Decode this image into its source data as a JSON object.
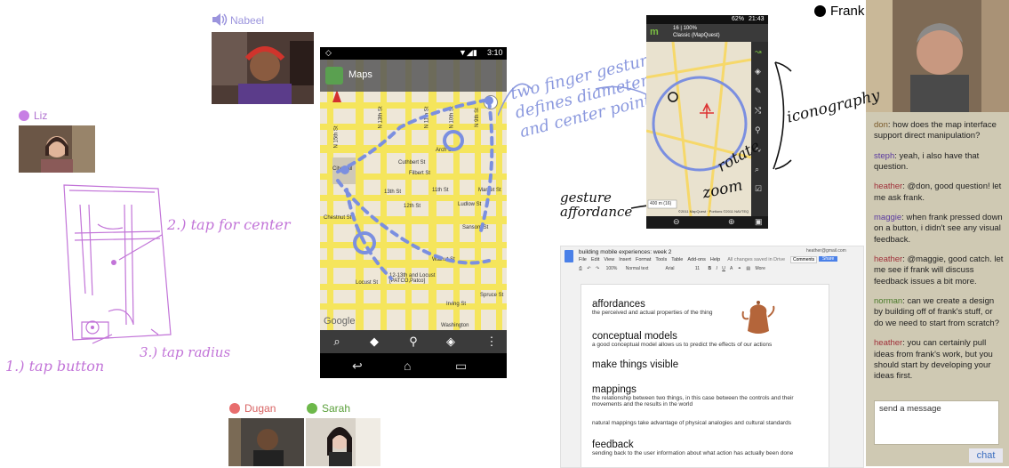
{
  "participants": {
    "nabeel": {
      "name": "Nabeel",
      "color": "#b0a8e6"
    },
    "liz": {
      "name": "Liz",
      "color": "#c77ee4"
    },
    "dugan": {
      "name": "Dugan",
      "color": "#e86d6d"
    },
    "sarah": {
      "name": "Sarah",
      "color": "#6db84a"
    },
    "frank": {
      "name": "Frank",
      "color": "#000000"
    }
  },
  "sketch": {
    "tap_center": "2.) tap for center",
    "tap_radius": "3.) tap radius",
    "tap_button": "1.) tap button"
  },
  "map_phone": {
    "time": "3:10",
    "app_title": "Maps",
    "google": "Google",
    "washington": "Washington",
    "streets": {
      "n15": "N 15th St",
      "n16": "N 16th St",
      "n13": "N 13th St",
      "n11": "N 11th St",
      "n12": "N 12th St",
      "n10": "N 10th St",
      "n9": "N 9th St",
      "n8": "N 8th St",
      "n7": "N 7th St",
      "n6": "N 6th St",
      "n5": "N Broad St",
      "cuthbert": "Cuthbert St",
      "arch": "Arch St",
      "filbert": "Filbert St",
      "market": "Market St",
      "s13": "13th St",
      "s11": "11th St",
      "s12": "12th St",
      "ludlow": "Ludlow St",
      "chestnut": "Chestnut St",
      "sansom": "Sansom St",
      "walnut": "Walnut St",
      "locust": "Locust St",
      "spruce": "Spruce St",
      "irving": "Irving St",
      "cityhall": "City Hall",
      "station": "12-13th and Locust [PATCO,Patco]",
      "chestnut2": "Chestnut St"
    }
  },
  "annotations": {
    "two_finger": "two finger gesture defines diameter and center point",
    "rotate": "rotate",
    "zoom": "zoom",
    "iconography": "iconography",
    "gesture_affordance": "gesture affordance"
  },
  "mapquest_phone": {
    "time": "21:43",
    "battery": "62%",
    "title_line1": "16 | 100%",
    "title_line2": "Classic (MapQuest)",
    "scale": "400 m (16)",
    "copyright": "©2011 MapQuest · Portions ©2011 NAVTEQ"
  },
  "doc": {
    "title": "building mobile experiences: week 2",
    "menu": [
      "File",
      "Edit",
      "View",
      "Insert",
      "Format",
      "Tools",
      "Table",
      "Add-ons",
      "Help"
    ],
    "saved": "All changes saved in Drive",
    "user": "heather@gmail.com",
    "comments": "Comments",
    "share": "Share",
    "zoom": "100%",
    "style": "Normal text",
    "font": "Arial",
    "size": "11",
    "more": "More",
    "sections": [
      {
        "heading": "affordances",
        "body": "the perceived and actual properties of the thing"
      },
      {
        "heading": "conceptual models",
        "body": "a good conceptual model allows us to predict the effects of our actions"
      },
      {
        "heading": "make things visible",
        "body": ""
      },
      {
        "heading": "mappings",
        "body": "the relationship between two things, in this case between the controls and their movements and the results in the world"
      },
      {
        "heading": "",
        "body": "natural mappings take advantage of physical analogies and cultural standards"
      },
      {
        "heading": "feedback",
        "body": "sending back to the user information about what action has actually been done"
      }
    ]
  },
  "chat": {
    "messages": [
      {
        "user": "don",
        "text": "how does the map interface support direct manipulation?",
        "color": "#7a5a2a"
      },
      {
        "user": "steph",
        "text": "yeah, i also have that question.",
        "color": "#5a3aa0"
      },
      {
        "user": "heather",
        "text": "@don, good question! let me ask frank.",
        "color": "#a0303a"
      },
      {
        "user": "maggie",
        "text": "when frank pressed down on a button, i didn't see any visual feedback.",
        "color": "#5a3aa0"
      },
      {
        "user": "heather",
        "text": "@maggie, good catch. let me see if frank will discuss feedback issues a bit more.",
        "color": "#a0303a"
      },
      {
        "user": "norman",
        "text": "can we create a design by building off of frank's stuff, or do we need to start from scratch?",
        "color": "#4a7a2a"
      },
      {
        "user": "heather",
        "text": "you can certainly pull ideas from frank's work, but you should start by developing your ideas first.",
        "color": "#a0303a"
      }
    ],
    "input_placeholder": "send a message",
    "send_label": "chat"
  }
}
